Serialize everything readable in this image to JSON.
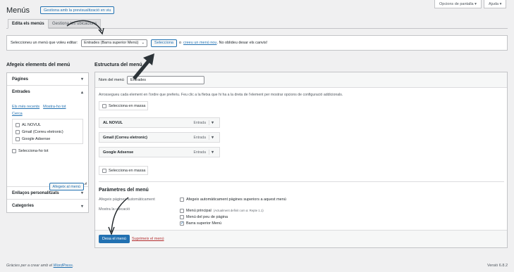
{
  "page": {
    "title": "Menús",
    "manage_preview_button": "Gestiona amb la previsualització en viu",
    "screen_options": "Opcions de pantalla",
    "help": "Ajuda"
  },
  "tabs": [
    {
      "label": "Edita els menús"
    },
    {
      "label": "Gestiona les ubicacions"
    }
  ],
  "select_bar": {
    "prompt": "Seleccioneu un menú que voleu editar:",
    "selected_menu": "Entrades (Barra superior Menú)",
    "select_button": "Selecciona",
    "or": "o",
    "create_link": "creeu un menú nou",
    "remember": ". No oblideu desar els canvis!"
  },
  "left": {
    "heading": "Afegeix elements del menú",
    "sections": [
      {
        "label": "Pàgines"
      },
      {
        "label": "Entrades"
      },
      {
        "label": "Enllaços personalitzats"
      },
      {
        "label": "Categories"
      }
    ],
    "post_tabs": [
      "Els més recents",
      "Mostra-ho tot",
      "Cerca"
    ],
    "posts": [
      {
        "label": "AL NOVUL"
      },
      {
        "label": "Gmail (Correu eletronic)"
      },
      {
        "label": "Google Adsense"
      }
    ],
    "select_all": "Selecciona-ho tot",
    "add_button": "Afegeix al menú"
  },
  "right": {
    "heading": "Estructura del menú",
    "menu_name_label": "Nom del menú",
    "menu_name_value": "Entrades",
    "instructions": "Arrossegueu cada element en l'ordre que preferiu. Feu clic a la fletxa que hi ha a la dreta de l'element per mostrar opcions de configuració addicionals.",
    "bulk_select": "Selecciona en massa",
    "items": [
      {
        "label": "AL NOVUL",
        "type": "Entrada"
      },
      {
        "label": "Gmail (Correu eletronic)",
        "type": "Entrada"
      },
      {
        "label": "Google Adsense",
        "type": "Entrada"
      }
    ],
    "settings_heading": "Paràmetres del menú",
    "auto_add_label": "Afegeix pàgines automàticament",
    "auto_add_option": "Afegeix automàticament pàgines superiors a aquest menú",
    "location_label": "Mostra la ubicació",
    "locations": [
      {
        "label": "Menú principal",
        "note": "(Actualment definit com a: Repte 1.1)",
        "checked": false
      },
      {
        "label": "Menú del peu de pàgina",
        "note": "",
        "checked": false
      },
      {
        "label": "Barra superior Menú",
        "note": "",
        "checked": true
      }
    ],
    "save_button": "Desa el menú",
    "delete_link": "Suprimeix el menú"
  },
  "footer": {
    "thanks": "Gràcies per a crear amb el",
    "wp_link": "WordPress",
    "period": ".",
    "version": "Versió 6.8.2"
  },
  "colors": {
    "accent": "#2271b1",
    "delete": "#b32d2e",
    "background": "#f0f0f1"
  }
}
